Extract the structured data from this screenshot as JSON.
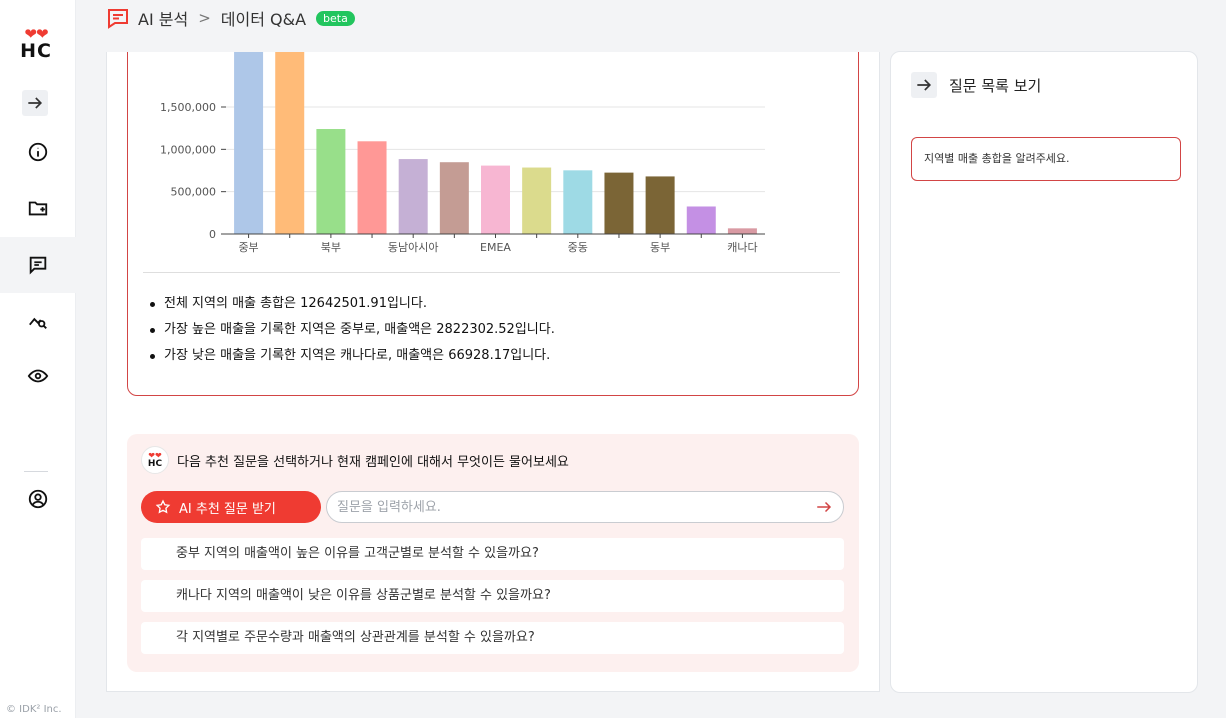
{
  "logo": {
    "top": "❤❤",
    "bottom": "HC"
  },
  "copyright": "© IDK² Inc.",
  "header": {
    "section": "AI 분석",
    "page": "데이터 Q&A",
    "badge": "beta"
  },
  "chart_data": {
    "type": "bar",
    "categories": [
      "중부",
      "",
      "북부",
      "",
      "동남아시아",
      "",
      "EMEA",
      "",
      "중동",
      "",
      "동부",
      "",
      "캐나다"
    ],
    "values": [
      2822302.52,
      2250000,
      1240000,
      1095000,
      885000,
      848000,
      808000,
      785000,
      752000,
      725000,
      680000,
      325000,
      66928.17
    ],
    "colors": [
      "#aec7e8",
      "#ffbb78",
      "#98df8a",
      "#ff9896",
      "#c5b0d5",
      "#c49c94",
      "#f7b6d2",
      "#dbdb8d",
      "#9edae5",
      "#7b6536",
      "#7b6536",
      "#c490e4",
      "#d99aa3"
    ],
    "yticks": [
      0,
      500000,
      1000000,
      1500000
    ],
    "ytick_labels": [
      "0",
      "500,000",
      "1,000,000",
      "1,500,000"
    ],
    "ylim": [
      0,
      1500000
    ],
    "grid": true
  },
  "answer": {
    "bullets": [
      "전체 지역의 매출 총합은 12642501.91입니다.",
      "가장 높은 매출을 기록한 지역은 중부로, 매출액은 2822302.52입니다.",
      "가장 낮은 매출을 기록한 지역은 캐나다로, 매출액은 66928.17입니다."
    ]
  },
  "suggest": {
    "prompt": "다음 추천 질문을 선택하거나 현재 캠페인에 대해서 무엇이든 물어보세요",
    "ai_button": "AI 추천 질문 받기",
    "input_placeholder": "질문을 입력하세요.",
    "questions": [
      "중부 지역의 매출액이 높은 이유를 고객군별로 분석할 수 있을까요?",
      "캐나다 지역의 매출액이 낮은 이유를 상품군별로 분석할 수 있을까요?",
      "각 지역별로 주문수량과 매출액의 상관관계를 분석할 수 있을까요?"
    ]
  },
  "right": {
    "title": "질문 목록 보기",
    "history": [
      "지역별 매출 총합을 알려주세요."
    ]
  },
  "colors": {
    "accent": "#ef3b32",
    "border_accent": "#d24545",
    "badge": "#22c55e"
  }
}
